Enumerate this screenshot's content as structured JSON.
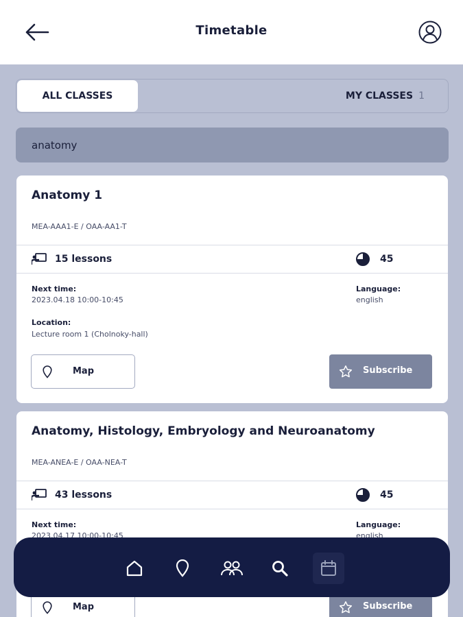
{
  "header": {
    "title": "Timetable"
  },
  "tabs": {
    "all": "ALL CLASSES",
    "mine": "MY CLASSES",
    "mine_count": "1"
  },
  "search": {
    "value": "anatomy"
  },
  "classes": [
    {
      "title": "Anatomy 1",
      "code": "MEA-AAA1-E / OAA-AA1-T",
      "lessons": "15 lessons",
      "duration": "45",
      "next_label": "Next time:",
      "next_value": "2023.04.18 10:00-10:45",
      "language_label": "Language:",
      "language_value": "english",
      "location_label": "Location:",
      "location_value": "Lecture room 1 (Cholnoky-hall)",
      "map_label": "Map",
      "subscribe_label": "Subscribe"
    },
    {
      "title": "Anatomy, Histology, Embryology and Neuroanatomy",
      "code": "MEA-ANEA-E / OAA-NEA-T",
      "lessons": "43 lessons",
      "duration": "45",
      "next_label": "Next time:",
      "next_value": "2023.04.17 10:00-10:45",
      "language_label": "Language:",
      "language_value": "english",
      "map_label": "Map",
      "subscribe_label": "Subscribe"
    }
  ],
  "nav": {
    "items": [
      "home-icon",
      "location-pin-icon",
      "people-icon",
      "search-icon",
      "calendar-icon"
    ],
    "active": "calendar-icon"
  },
  "colors": {
    "navy": "#141c44",
    "background": "#b9bfd3",
    "search_bg": "#8f98b1",
    "subscribe_bg": "#7c859f"
  }
}
